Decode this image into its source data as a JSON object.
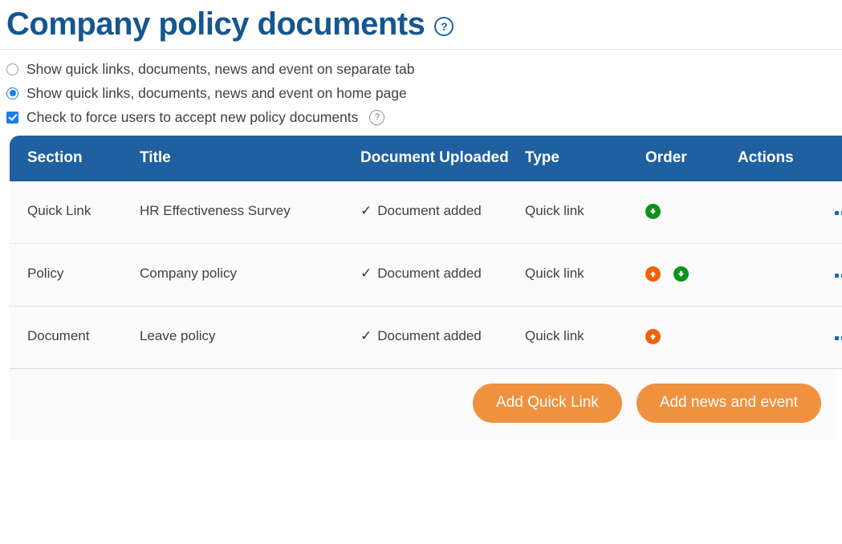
{
  "header": {
    "title": "Company policy documents",
    "help_icon": "question-circle-icon",
    "help_glyph": "?"
  },
  "options": {
    "radio_separate_tab": {
      "label": "Show quick links, documents, news and event on separate tab",
      "checked": false
    },
    "radio_home_page": {
      "label": "Show quick links, documents, news and event on home page",
      "checked": true
    },
    "checkbox_force_accept": {
      "label": "Check to force users to accept new policy documents",
      "checked": true,
      "help_glyph": "?"
    }
  },
  "table": {
    "columns": [
      "Section",
      "Title",
      "Document Uploaded",
      "Type",
      "Order",
      "Actions"
    ],
    "rows": [
      {
        "section": "Quick Link",
        "title": "HR Effectiveness Survey",
        "document_uploaded": "Document added",
        "check_glyph": "✓",
        "type": "Quick link",
        "order_up": false,
        "order_down": true,
        "actions": "•••"
      },
      {
        "section": "Policy",
        "title": "Company policy",
        "document_uploaded": "Document added",
        "check_glyph": "✓",
        "type": "Quick link",
        "order_up": true,
        "order_down": true,
        "actions": "•••"
      },
      {
        "section": "Document",
        "title": "Leave policy",
        "document_uploaded": "Document added",
        "check_glyph": "✓",
        "type": "Quick link",
        "order_up": true,
        "order_down": false,
        "actions": "•••"
      }
    ]
  },
  "footer": {
    "add_quick_link_label": "Add Quick Link",
    "add_news_event_label": "Add news and event"
  },
  "colors": {
    "title_blue": "#15568f",
    "header_blue": "#1f60a0",
    "accent_orange": "#f0913f",
    "arrow_up_orange": "#f1610b",
    "arrow_down_green": "#0f9219",
    "control_blue": "#1b7ced",
    "row_bg": "#fbfbfc"
  }
}
